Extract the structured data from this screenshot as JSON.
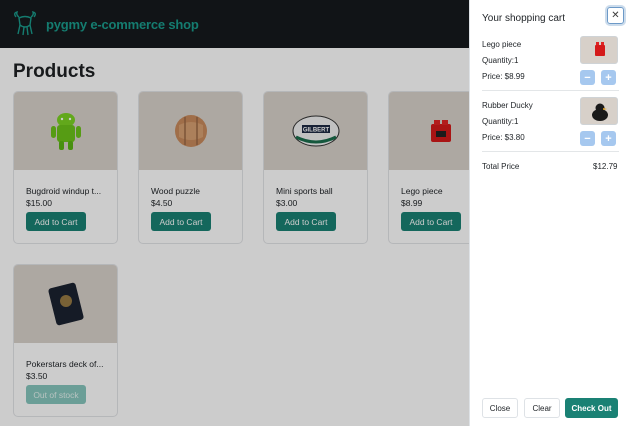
{
  "navbar": {
    "brand": "pygmy e-commerce shop",
    "logo_icon": "goat-logo-icon"
  },
  "page": {
    "title": "Products"
  },
  "products": [
    {
      "name": "Bugdroid windup t...",
      "price": "$15.00",
      "button": "Add to Cart",
      "image": "green-robot-toy"
    },
    {
      "name": "Wood puzzle",
      "price": "$4.50",
      "button": "Add to Cart",
      "image": "wood-puzzle-ball"
    },
    {
      "name": "Mini sports ball",
      "price": "$3.00",
      "button": "Add to Cart",
      "image": "rugby-ball"
    },
    {
      "name": "Lego piece",
      "price": "$8.99",
      "button": "Add to Cart",
      "image": "red-lego-brick"
    },
    {
      "name": "Pokerstars deck of...",
      "price": "$3.50",
      "button": "Out of stock",
      "image": "card-deck"
    }
  ],
  "cart": {
    "title": "Your shopping cart",
    "close_icon": "close-icon",
    "items": [
      {
        "name": "Lego piece",
        "quantity": "Quantity:1",
        "price": "Price: $8.99",
        "minus": "−",
        "plus": "+"
      },
      {
        "name": "Rubber Ducky",
        "quantity": "Quantity:1",
        "price": "Price: $3.80",
        "minus": "−",
        "plus": "+"
      }
    ],
    "total_label": "Total Price",
    "total_value": "$12.79",
    "buttons": {
      "close": "Close",
      "clear": "Clear",
      "checkout": "Check Out"
    }
  },
  "colors": {
    "accent": "#1a8174",
    "brand": "#1a9c8c",
    "navbar": "#16191d"
  }
}
